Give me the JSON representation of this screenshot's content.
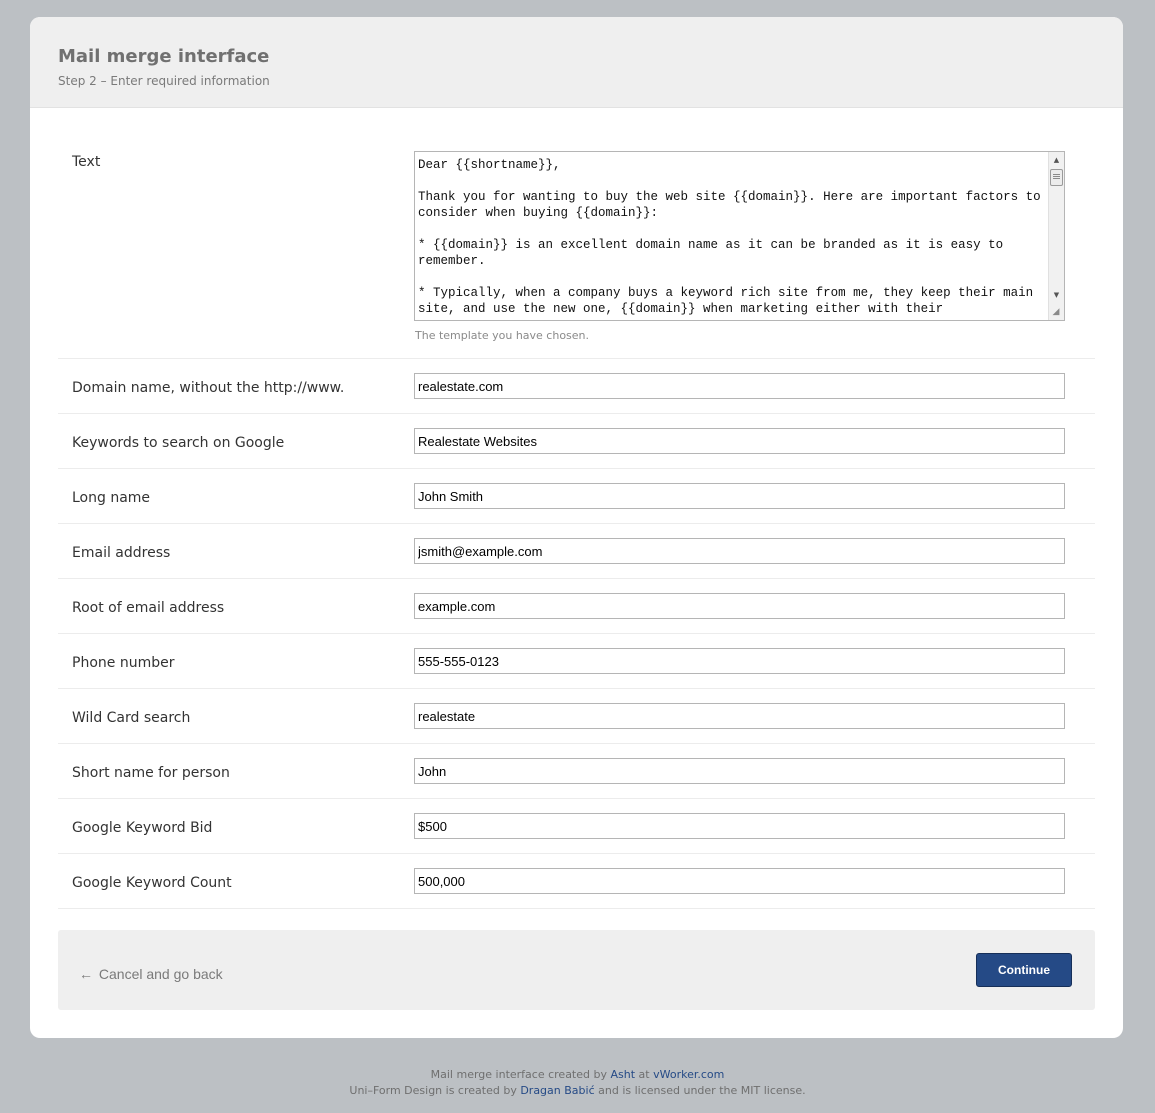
{
  "header": {
    "title": "Mail merge interface",
    "subtitle": "Step 2 – Enter required information"
  },
  "text_field": {
    "label": "Text",
    "value": "Dear {{shortname}},\n\nThank you for wanting to buy the web site {{domain}}. Here are important factors to consider when buying {{domain}}:\n\n* {{domain}} is an excellent domain name as it can be branded as it is easy to remember.\n\n* Typically, when a company buys a keyword rich site from me, they keep their main site, and use the new one, {{domain}} when marketing either with their",
    "hint": "The template you have chosen."
  },
  "fields": [
    {
      "label": "Domain name, without the http://www.",
      "value": "realestate.com"
    },
    {
      "label": "Keywords to search on Google",
      "value": "Realestate Websites"
    },
    {
      "label": "Long name",
      "value": "John Smith"
    },
    {
      "label": "Email address",
      "value": "jsmith@example.com"
    },
    {
      "label": "Root of email address",
      "value": "example.com"
    },
    {
      "label": "Phone number",
      "value": "555-555-0123"
    },
    {
      "label": "Wild Card search",
      "value": "realestate"
    },
    {
      "label": "Short name for person",
      "value": "John"
    },
    {
      "label": "Google Keyword Bid",
      "value": "$500"
    },
    {
      "label": "Google Keyword Count",
      "value": "500,000"
    }
  ],
  "buttons": {
    "cancel_arrow": "←",
    "cancel_label": "Cancel and go back",
    "continue_label": "Continue"
  },
  "footer": {
    "line1_prefix": "Mail merge interface created by",
    "line1_author": "Asht",
    "line1_at": "at",
    "line1_site": "vWorker.com",
    "line2_prefix": "Uni–Form Design is created by",
    "line2_author": "Dragan Babić",
    "line2_suffix": "and is licensed under the MIT license."
  },
  "colors": {
    "background": "#bcc0c4",
    "header_bg": "#efefef",
    "accent": "#254a86"
  }
}
